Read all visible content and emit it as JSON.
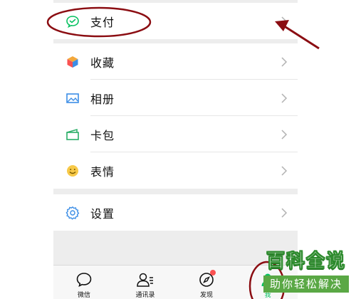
{
  "menu": {
    "group1": [
      {
        "label": "支付",
        "icon": "wallet-icon"
      }
    ],
    "group2": [
      {
        "label": "收藏",
        "icon": "favorites-cube-icon"
      },
      {
        "label": "相册",
        "icon": "album-icon"
      },
      {
        "label": "卡包",
        "icon": "card-package-icon"
      },
      {
        "label": "表情",
        "icon": "emoji-icon"
      }
    ],
    "group3": [
      {
        "label": "设置",
        "icon": "gear-icon"
      }
    ]
  },
  "tabbar": {
    "tabs": [
      {
        "label": "微信",
        "icon": "chat-bubble-icon"
      },
      {
        "label": "通讯录",
        "icon": "contacts-icon"
      },
      {
        "label": "发现",
        "icon": "compass-icon",
        "badge": true
      },
      {
        "label": "我",
        "icon": "person-icon",
        "active": true
      }
    ]
  },
  "watermark": {
    "title": "百科全说",
    "subtitle": "助你轻松解决"
  },
  "colors": {
    "accent_green": "#07c160",
    "annotation_red": "#8b0d12",
    "badge_red": "#fa5151",
    "background_gray": "#ededed"
  }
}
